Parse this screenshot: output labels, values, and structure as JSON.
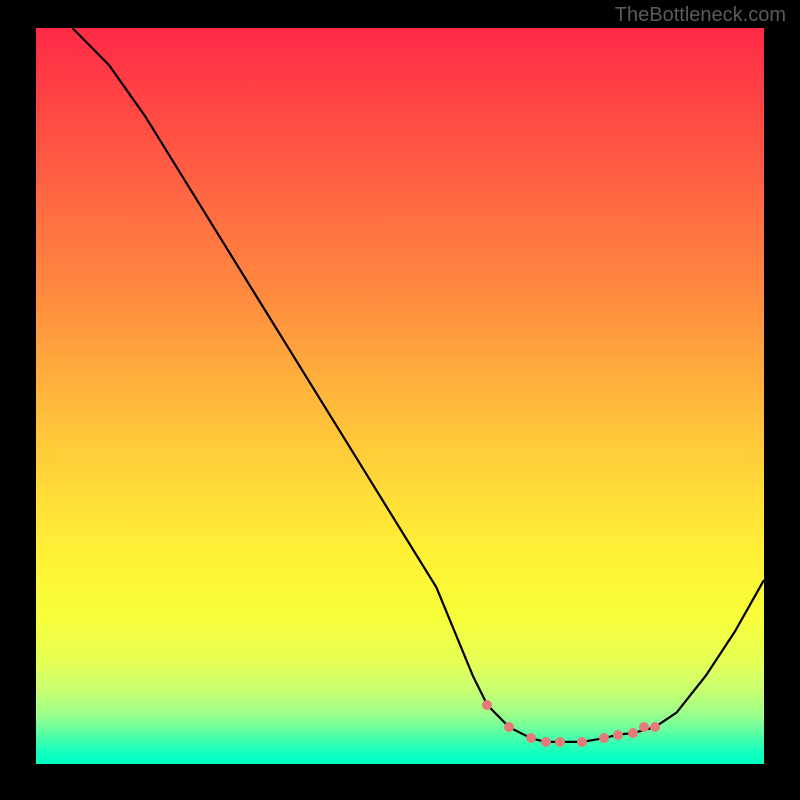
{
  "watermark": "TheBottleneck.com",
  "chart_data": {
    "type": "line",
    "title": "",
    "xlabel": "",
    "ylabel": "",
    "xlim": [
      0,
      100
    ],
    "ylim": [
      0,
      100
    ],
    "x": [
      5,
      10,
      15,
      20,
      25,
      30,
      35,
      40,
      45,
      50,
      55,
      60,
      62,
      65,
      68,
      70,
      72,
      75,
      78,
      80,
      82,
      85,
      88,
      92,
      96,
      100
    ],
    "y": [
      100,
      95,
      88,
      80,
      72,
      64,
      56,
      48,
      40,
      32,
      24,
      12,
      8,
      5,
      3.5,
      3,
      3,
      3,
      3.5,
      4,
      4.2,
      5,
      7,
      12,
      18,
      25
    ],
    "series": [
      {
        "name": "curve",
        "color": "#000000"
      }
    ],
    "markers": [
      {
        "x": 62,
        "y": 8
      },
      {
        "x": 65,
        "y": 5
      },
      {
        "x": 68,
        "y": 3.5
      },
      {
        "x": 70,
        "y": 3
      },
      {
        "x": 72,
        "y": 3
      },
      {
        "x": 75,
        "y": 3
      },
      {
        "x": 78,
        "y": 3.5
      },
      {
        "x": 80,
        "y": 4
      },
      {
        "x": 82,
        "y": 4.2
      },
      {
        "x": 83.5,
        "y": 5
      },
      {
        "x": 85,
        "y": 5
      }
    ],
    "marker_color": "#e47a7a",
    "background_gradient": {
      "top": "#ff2a46",
      "bottom": "#00ffc4"
    }
  }
}
